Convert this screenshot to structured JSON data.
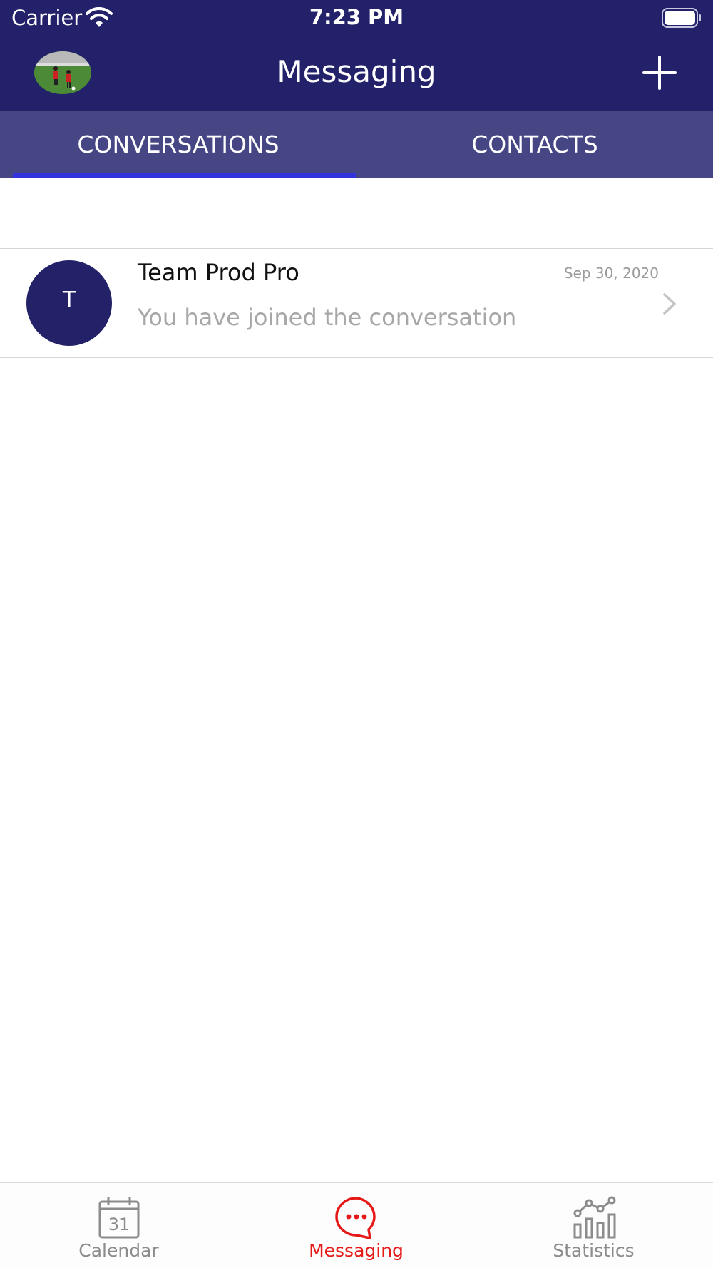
{
  "status_bar": {
    "carrier": "Carrier",
    "time": "7:23 PM"
  },
  "nav": {
    "title": "Messaging",
    "profile_icon": "profile-photo",
    "add_icon": "plus-icon"
  },
  "tabs": [
    {
      "label": "CONVERSATIONS",
      "selected": true
    },
    {
      "label": "CONTACTS",
      "selected": false
    }
  ],
  "conversations": [
    {
      "initial": "T",
      "name": "Team Prod Pro",
      "date": "Sep 30, 2020",
      "preview": "You have joined the conversation"
    }
  ],
  "bottom_nav": {
    "items": [
      {
        "label": "Calendar",
        "icon": "calendar-icon",
        "badge_number": "31",
        "active": false
      },
      {
        "label": "Messaging",
        "icon": "chat-bubble-icon",
        "active": true
      },
      {
        "label": "Statistics",
        "icon": "bar-chart-icon",
        "active": false
      }
    ]
  },
  "colors": {
    "header_bg": "#222169",
    "tab_bg": "#464684",
    "tab_indicator": "#3333dd",
    "active_red": "#e61919",
    "inactive_gray": "#8c8c8c"
  }
}
